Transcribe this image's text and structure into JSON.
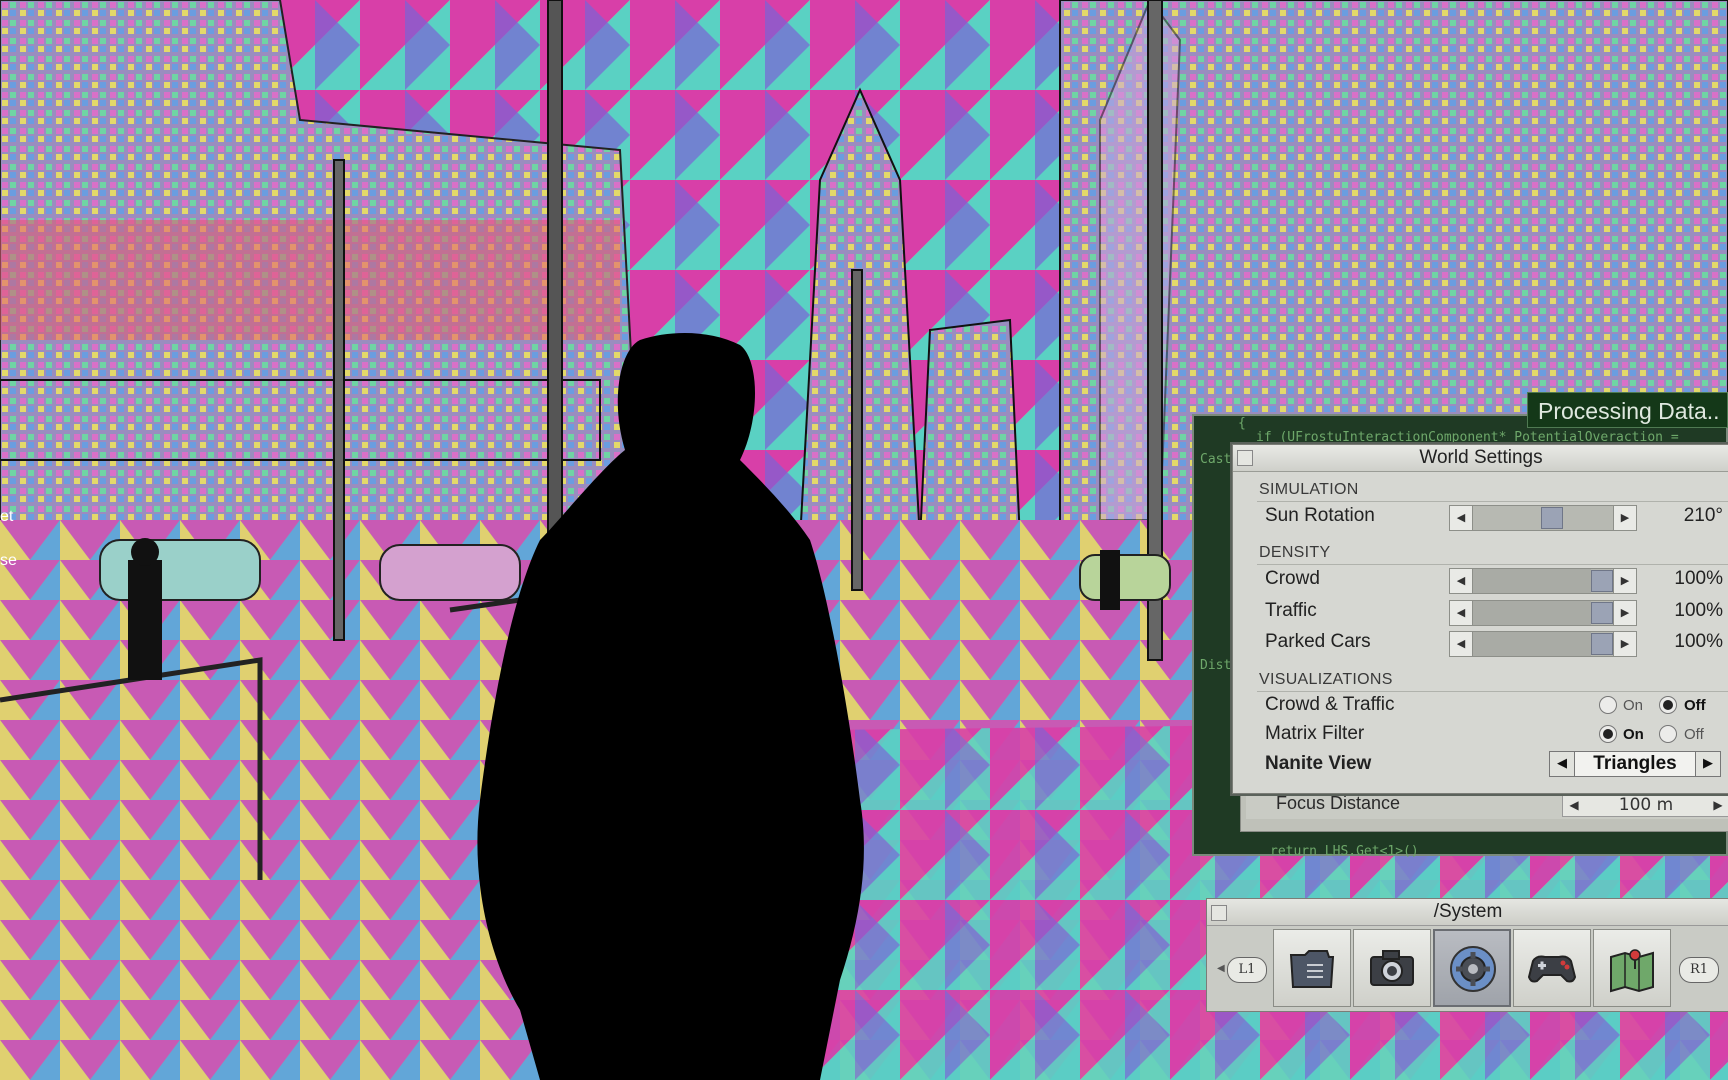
{
  "hud": {
    "processing_text": "Processing Data..",
    "code_lines": [
      "{",
      "if (UFrostuInteractionComponent* PotentialOveraction =",
      "Cast",
      "Dista",
      "return LHS.Get<1>()"
    ],
    "left_edge_text": [
      "et",
      "se"
    ]
  },
  "world_settings": {
    "title": "World Settings",
    "sections": {
      "simulation": "SIMULATION",
      "density": "DENSITY",
      "visualizations": "VISUALIZATIONS"
    },
    "sun_rotation": {
      "label": "Sun Rotation",
      "value": "210°",
      "level": 0.58
    },
    "crowd": {
      "label": "Crowd",
      "value": "100%",
      "level": 1.0
    },
    "traffic": {
      "label": "Traffic",
      "value": "100%",
      "level": 1.0
    },
    "parked_cars": {
      "label": "Parked Cars",
      "value": "100%",
      "level": 1.0
    },
    "crowd_traffic": {
      "label": "Crowd & Traffic",
      "on_label": "On",
      "off_label": "Off",
      "selected": "Off"
    },
    "matrix_filter": {
      "label": "Matrix Filter",
      "on_label": "On",
      "off_label": "Off",
      "selected": "On"
    },
    "nanite_view": {
      "label": "Nanite View",
      "value": "Triangles"
    },
    "focus_distance": {
      "label": "Focus Distance",
      "value": "100 m"
    }
  },
  "system_bar": {
    "title": "/System",
    "left_bumper": "L1",
    "right_bumper": "R1",
    "buttons": [
      "files",
      "camera",
      "settings",
      "gamepad",
      "map"
    ],
    "active": "settings"
  },
  "colors": {
    "panel_bg": "#d6d7d2",
    "code_bg": "#1f3a24",
    "code_text": "#6ea86a",
    "processing_bg": "#143818"
  }
}
